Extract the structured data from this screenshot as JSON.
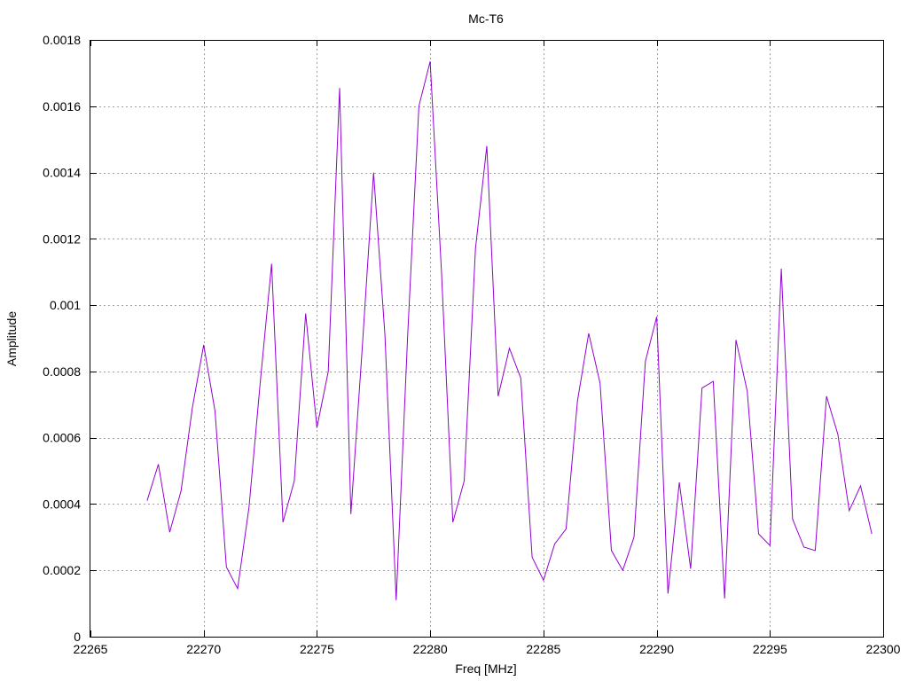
{
  "chart_data": {
    "type": "line",
    "title": "Mc-T6",
    "xlabel": "Freq [MHz]",
    "ylabel": "Amplitude",
    "xlim": [
      22265,
      22300
    ],
    "ylim": [
      0,
      0.0018
    ],
    "grid": true,
    "xticks": [
      22265,
      22270,
      22275,
      22280,
      22285,
      22290,
      22295,
      22300
    ],
    "xtick_labels": [
      "22265",
      "22270",
      "22275",
      "22280",
      "22285",
      "22290",
      "22295",
      "22300"
    ],
    "yticks": [
      0,
      0.0002,
      0.0004,
      0.0006,
      0.0008,
      0.001,
      0.0012,
      0.0014,
      0.0016,
      0.0018
    ],
    "ytick_labels": [
      "0",
      "0.0002",
      "0.0004",
      "0.0006",
      "0.0008",
      "0.001",
      "0.0012",
      "0.0014",
      "0.0016",
      "0.0018"
    ],
    "color": "#9400d3",
    "series": [
      {
        "x": [
          22267.5,
          22268.0,
          22268.5,
          22269.0,
          22269.5,
          22270.0,
          22270.5,
          22271.0,
          22271.5,
          22272.0,
          22272.5,
          22273.0,
          22273.5,
          22274.0,
          22274.5,
          22275.0,
          22275.5,
          22276.0,
          22276.5,
          22277.0,
          22277.5,
          22278.0,
          22278.5,
          22279.0,
          22279.5,
          22280.0,
          22280.5,
          22281.0,
          22281.5,
          22282.0,
          22282.5,
          22283.0,
          22283.5,
          22284.0,
          22284.5,
          22285.0,
          22285.5,
          22286.0,
          22286.5,
          22287.0,
          22287.5,
          22288.0,
          22288.5,
          22289.0,
          22289.5,
          22290.0,
          22290.5,
          22291.0,
          22291.5,
          22292.0,
          22292.5,
          22293.0,
          22293.5,
          22294.0,
          22294.5,
          22295.0,
          22295.5,
          22296.0,
          22296.5,
          22297.0,
          22297.5,
          22298.0,
          22298.5,
          22299.0,
          22299.5
        ],
        "values": [
          0.00041,
          0.00052,
          0.000315,
          0.00044,
          0.00069,
          0.00088,
          0.00068,
          0.00021,
          0.000145,
          0.00039,
          0.00077,
          0.001125,
          0.000345,
          0.00047,
          0.000975,
          0.00063,
          0.0008,
          0.001655,
          0.00037,
          0.00087,
          0.0014,
          0.00091,
          0.00011,
          0.0009,
          0.0016,
          0.001735,
          0.0011,
          0.000345,
          0.00047,
          0.00117,
          0.00148,
          0.000725,
          0.00087,
          0.00078,
          0.00024,
          0.00017,
          0.00028,
          0.000325,
          0.00071,
          0.000915,
          0.000765,
          0.00026,
          0.0002,
          0.0003,
          0.00083,
          0.000965,
          0.00013,
          0.000465,
          0.000205,
          0.00075,
          0.00077,
          0.000115,
          0.000895,
          0.00074,
          0.00031,
          0.000275,
          0.00111,
          0.000355,
          0.00027,
          0.00026,
          0.000725,
          0.00061,
          0.00038,
          0.000455,
          0.00031
        ]
      }
    ]
  }
}
